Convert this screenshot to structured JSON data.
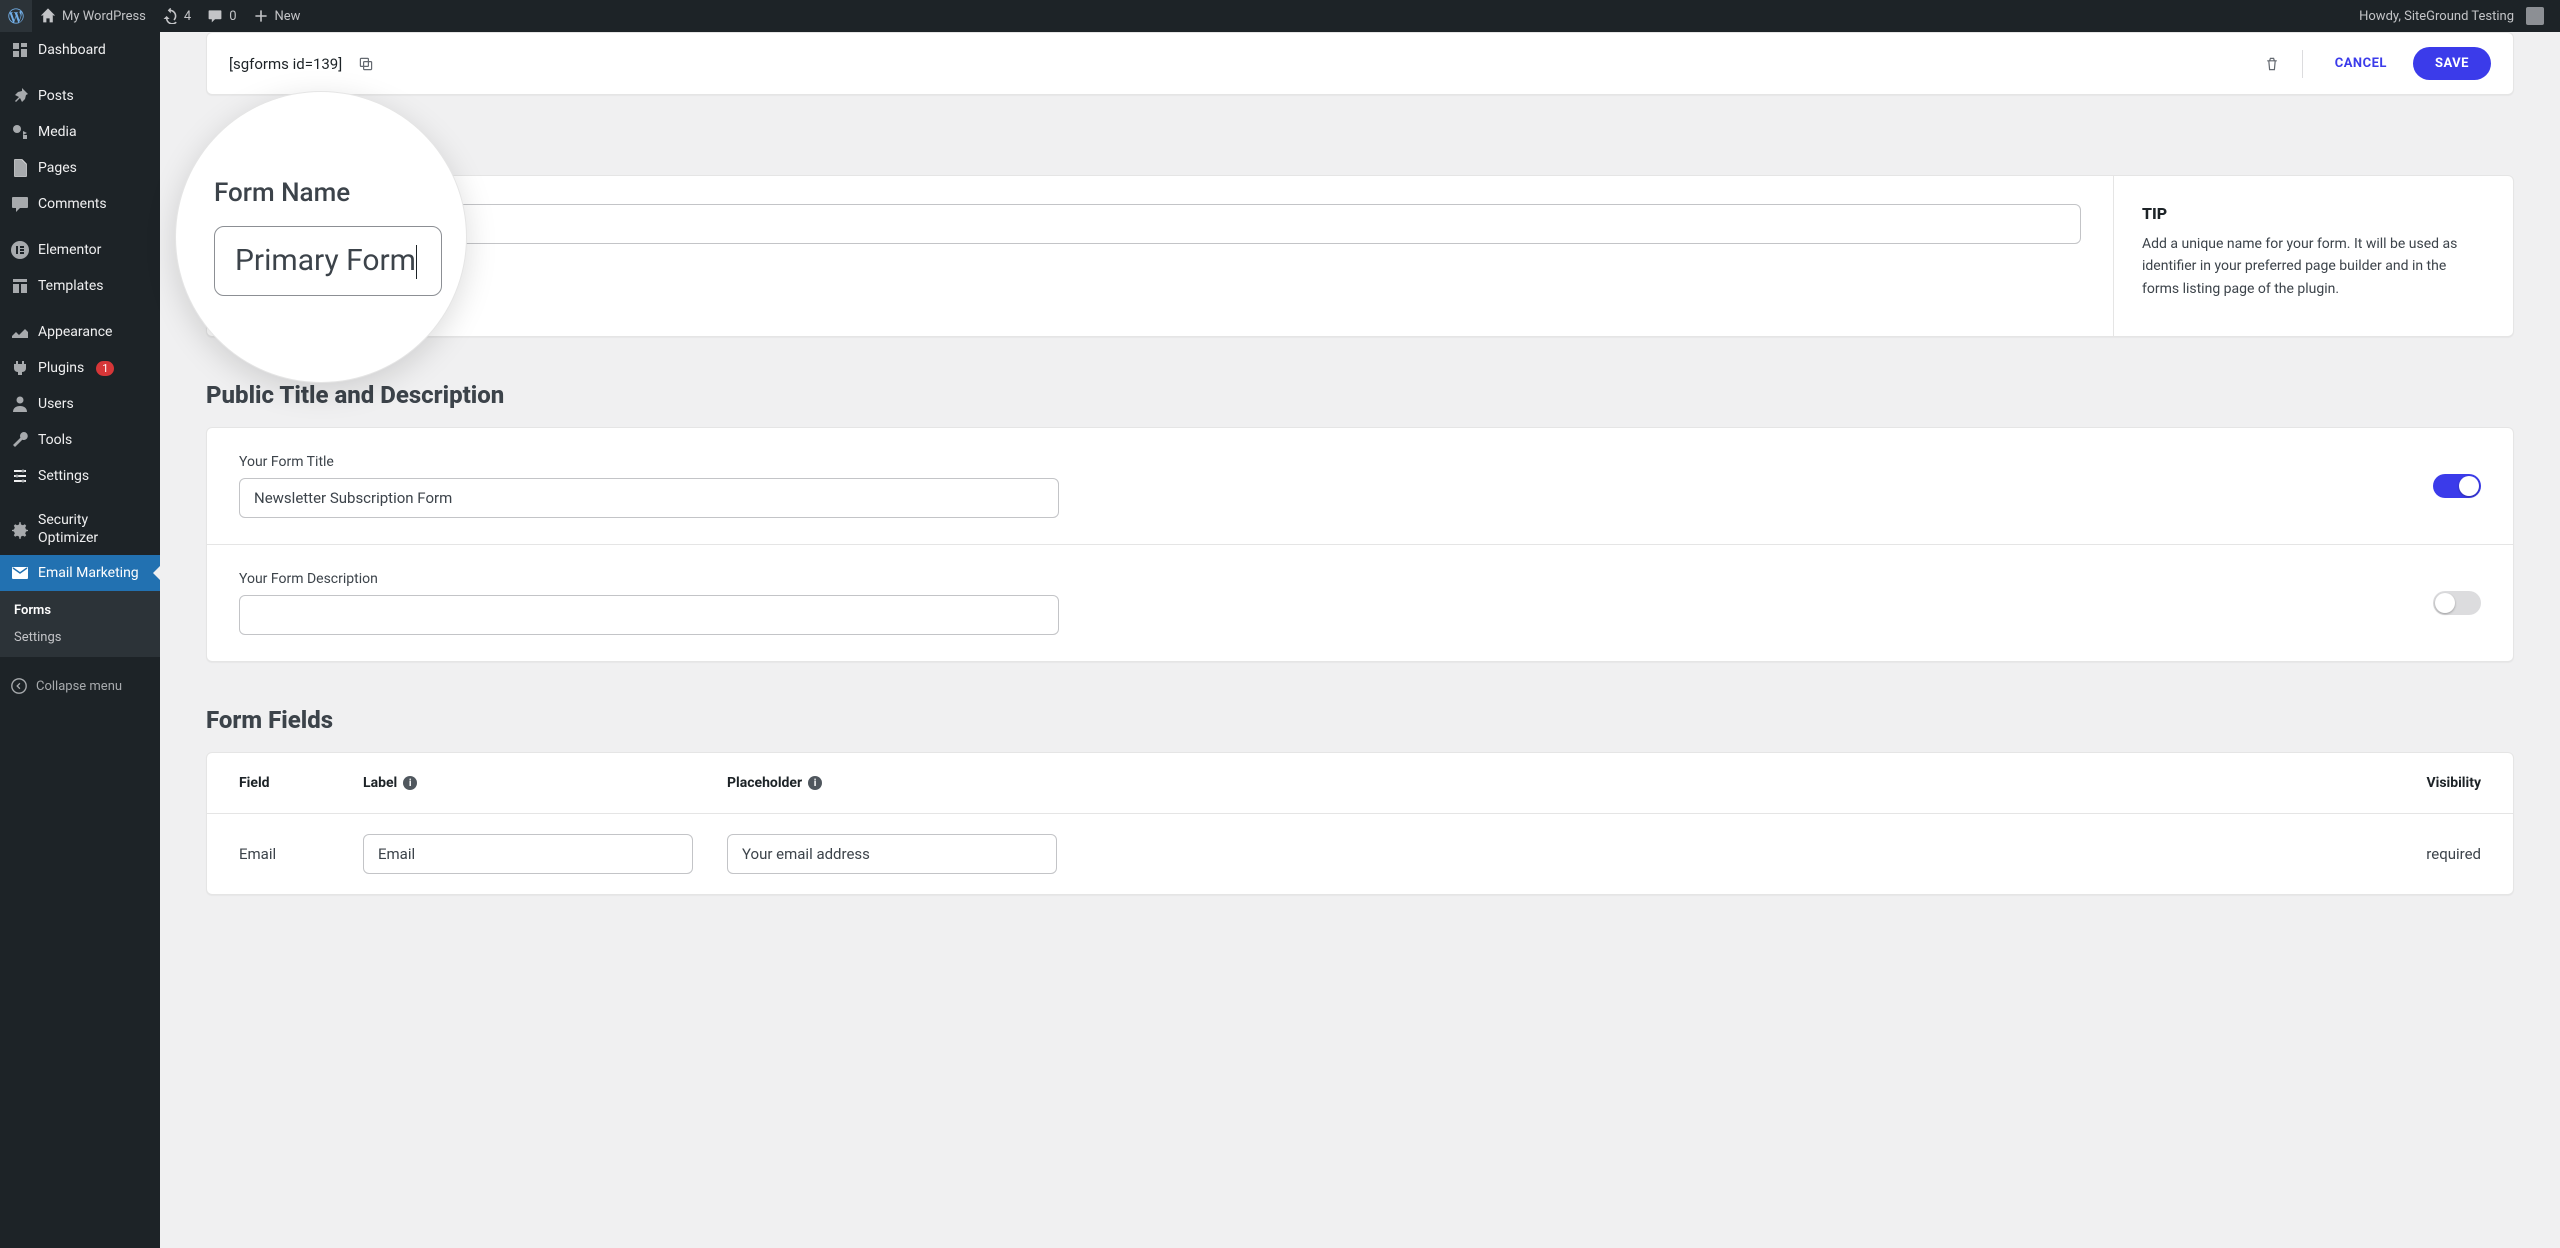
{
  "adminbar": {
    "site_name": "My WordPress",
    "refresh_count": "4",
    "comments_count": "0",
    "new_label": "New",
    "howdy": "Howdy, SiteGround Testing"
  },
  "sidebar": {
    "items": [
      {
        "icon": "dashboard",
        "label": "Dashboard"
      },
      {
        "icon": "pin",
        "label": "Posts"
      },
      {
        "icon": "media",
        "label": "Media"
      },
      {
        "icon": "page",
        "label": "Pages"
      },
      {
        "icon": "comment",
        "label": "Comments"
      },
      {
        "icon": "elementor",
        "label": "Elementor"
      },
      {
        "icon": "templates",
        "label": "Templates"
      },
      {
        "icon": "appearance",
        "label": "Appearance"
      },
      {
        "icon": "plugin",
        "label": "Plugins",
        "badge": "1"
      },
      {
        "icon": "user",
        "label": "Users"
      },
      {
        "icon": "tools",
        "label": "Tools"
      },
      {
        "icon": "settings",
        "label": "Settings"
      },
      {
        "icon": "optimizer",
        "label_line1": "Security",
        "label_line2": "Optimizer"
      },
      {
        "icon": "email",
        "label": "Email Marketing"
      }
    ],
    "submenu": {
      "forms": "Forms",
      "settings": "Settings"
    },
    "collapse": "Collapse menu"
  },
  "topbar": {
    "shortcode": "[sgforms id=139]",
    "cancel": "CANCEL",
    "save": "SAVE"
  },
  "lens": {
    "label": "Form Name",
    "value": "Primary Form"
  },
  "form_name": {
    "value": "Primary Form"
  },
  "tip": {
    "title": "TIP",
    "body": "Add a unique name for your form. It will be used as identifier in your preferred page builder and in the forms listing page of the plugin."
  },
  "public": {
    "section_title": "Public Title and Description",
    "title_label": "Your Form Title",
    "title_value": "Newsletter Subscription Form",
    "desc_label": "Your Form Description",
    "desc_value": ""
  },
  "fields": {
    "section_title": "Form Fields",
    "headers": {
      "field": "Field",
      "label": "Label",
      "placeholder": "Placeholder",
      "visibility": "Visibility"
    },
    "rows": [
      {
        "field": "Email",
        "label": "Email",
        "placeholder": "Your email address",
        "visibility": "required"
      }
    ]
  }
}
